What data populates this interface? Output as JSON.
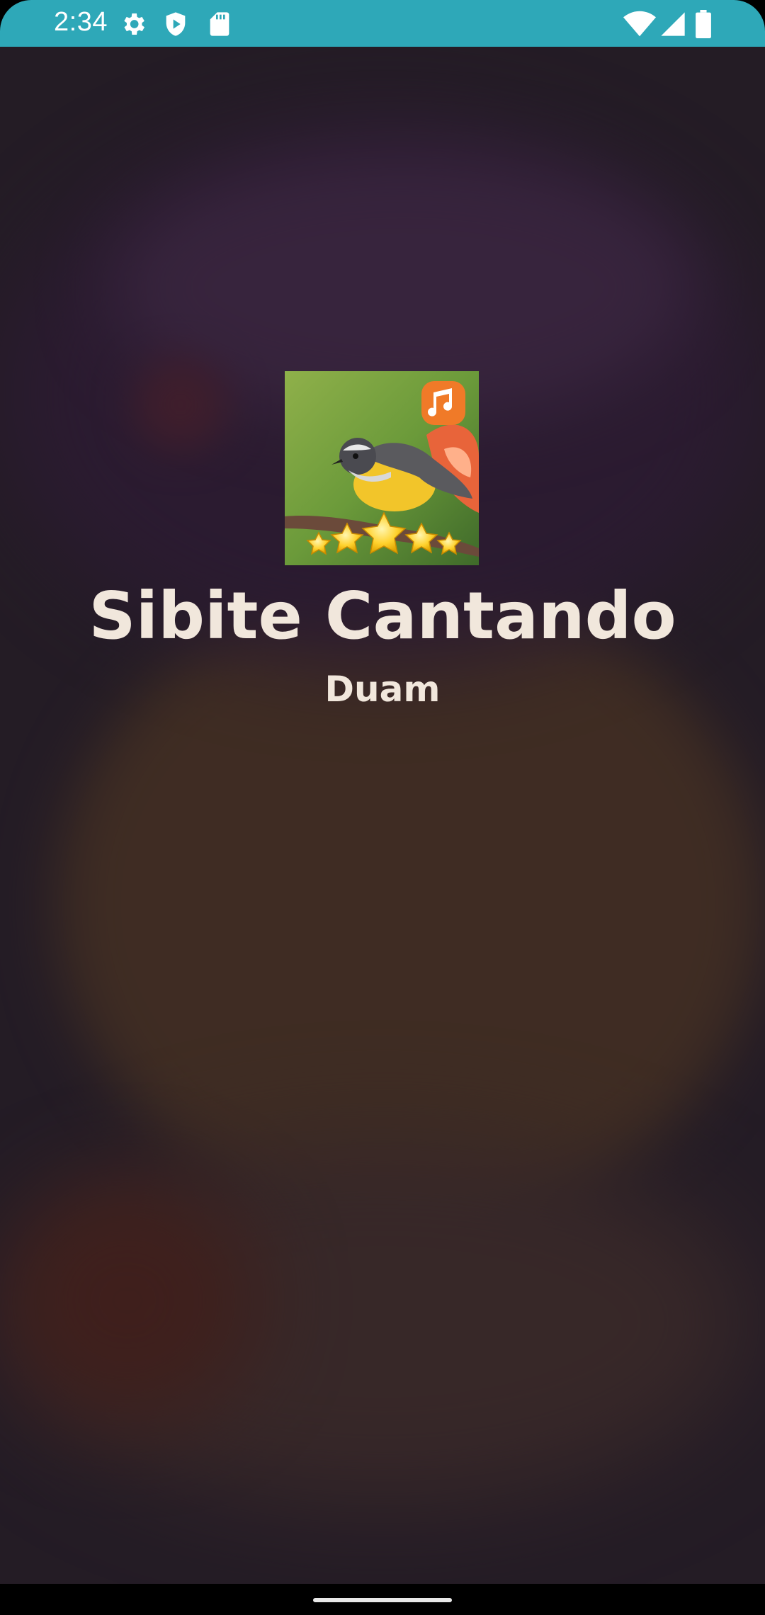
{
  "status_bar": {
    "time": "2:34",
    "left_icons": [
      "settings-icon",
      "play-protect-icon",
      "sd-card-icon"
    ],
    "right_icons": [
      "wifi-icon",
      "cell-signal-icon",
      "battery-icon"
    ],
    "background_color": "#2ea8b8"
  },
  "splash": {
    "app_icon": "app-icon-bird-with-stars-and-music-note",
    "title": "Sibite Cantando",
    "author": "Duam",
    "text_color": "#f1e7dc"
  },
  "navigation": {
    "gesture_handle": "home-gesture-handle"
  }
}
